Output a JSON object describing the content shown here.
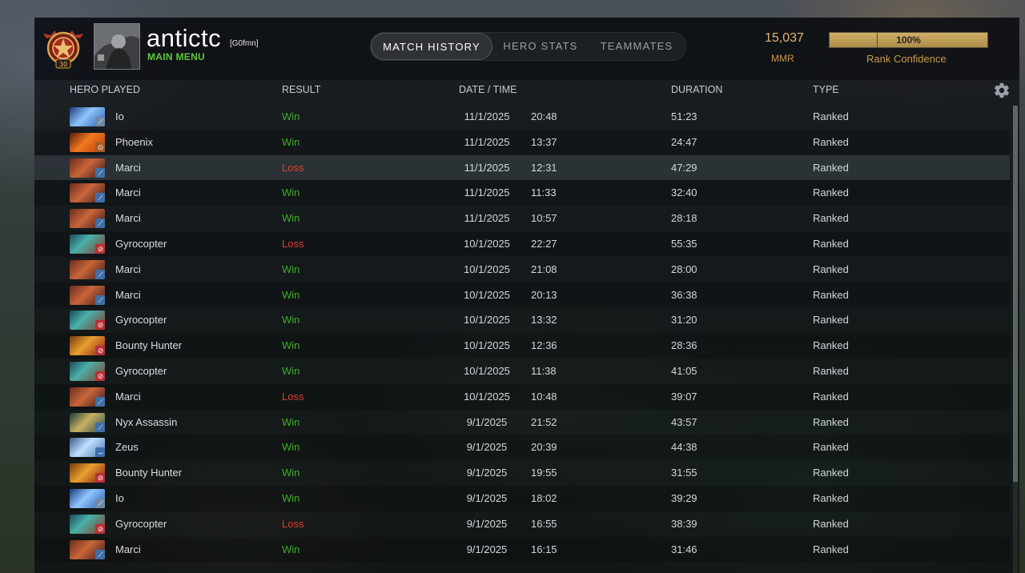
{
  "profile": {
    "username": "antictc",
    "tag": "[G0fmn]",
    "main_menu": "MAIN MENU",
    "rank_level": "30"
  },
  "tabs": [
    {
      "label": "MATCH HISTORY",
      "active": true
    },
    {
      "label": "HERO STATS",
      "active": false
    },
    {
      "label": "TEAMMATES",
      "active": false
    }
  ],
  "stats": {
    "mmr_value": "15,037",
    "mmr_label": "MMR",
    "confidence_text": "100%",
    "confidence_fraction": 1.0,
    "confidence_label": "Rank Confidence"
  },
  "columns": {
    "hero": "HERO PLAYED",
    "result": "RESULT",
    "datetime": "DATE / TIME",
    "duration": "DURATION",
    "type": "TYPE"
  },
  "colors": {
    "win": "#3fae2b",
    "loss": "#d9402f",
    "accent_gold": "#e2b66a",
    "main_menu_green": "#5ec93c"
  },
  "matches": [
    {
      "hero": "Io",
      "icon": "io-hero-icon",
      "result": "Win",
      "date": "11/1/2025",
      "time": "20:48",
      "duration": "51:23",
      "type": "Ranked"
    },
    {
      "hero": "Phoenix",
      "icon": "phoenix-hero-icon",
      "result": "Win",
      "date": "11/1/2025",
      "time": "13:37",
      "duration": "24:47",
      "type": "Ranked"
    },
    {
      "hero": "Marci",
      "icon": "marci-hero-icon",
      "result": "Loss",
      "date": "11/1/2025",
      "time": "12:31",
      "duration": "47:29",
      "type": "Ranked"
    },
    {
      "hero": "Marci",
      "icon": "marci-hero-icon",
      "result": "Win",
      "date": "11/1/2025",
      "time": "11:33",
      "duration": "32:40",
      "type": "Ranked"
    },
    {
      "hero": "Marci",
      "icon": "marci-hero-icon",
      "result": "Win",
      "date": "11/1/2025",
      "time": "10:57",
      "duration": "28:18",
      "type": "Ranked"
    },
    {
      "hero": "Gyrocopter",
      "icon": "gyrocopter-hero-icon",
      "result": "Loss",
      "date": "10/1/2025",
      "time": "22:27",
      "duration": "55:35",
      "type": "Ranked"
    },
    {
      "hero": "Marci",
      "icon": "marci-hero-icon",
      "result": "Win",
      "date": "10/1/2025",
      "time": "21:08",
      "duration": "28:00",
      "type": "Ranked"
    },
    {
      "hero": "Marci",
      "icon": "marci-hero-icon",
      "result": "Win",
      "date": "10/1/2025",
      "time": "20:13",
      "duration": "36:38",
      "type": "Ranked"
    },
    {
      "hero": "Gyrocopter",
      "icon": "gyrocopter-hero-icon",
      "result": "Win",
      "date": "10/1/2025",
      "time": "13:32",
      "duration": "31:20",
      "type": "Ranked"
    },
    {
      "hero": "Bounty Hunter",
      "icon": "bounty-hunter-hero-icon",
      "result": "Win",
      "date": "10/1/2025",
      "time": "12:36",
      "duration": "28:36",
      "type": "Ranked"
    },
    {
      "hero": "Gyrocopter",
      "icon": "gyrocopter-hero-icon",
      "result": "Win",
      "date": "10/1/2025",
      "time": "11:38",
      "duration": "41:05",
      "type": "Ranked"
    },
    {
      "hero": "Marci",
      "icon": "marci-hero-icon",
      "result": "Loss",
      "date": "10/1/2025",
      "time": "10:48",
      "duration": "39:07",
      "type": "Ranked"
    },
    {
      "hero": "Nyx Assassin",
      "icon": "nyx-assassin-hero-icon",
      "result": "Win",
      "date": "9/1/2025",
      "time": "21:52",
      "duration": "43:57",
      "type": "Ranked"
    },
    {
      "hero": "Zeus",
      "icon": "zeus-hero-icon",
      "result": "Win",
      "date": "9/1/2025",
      "time": "20:39",
      "duration": "44:38",
      "type": "Ranked"
    },
    {
      "hero": "Bounty Hunter",
      "icon": "bounty-hunter-hero-icon",
      "result": "Win",
      "date": "9/1/2025",
      "time": "19:55",
      "duration": "31:55",
      "type": "Ranked"
    },
    {
      "hero": "Io",
      "icon": "io-hero-icon",
      "result": "Win",
      "date": "9/1/2025",
      "time": "18:02",
      "duration": "39:29",
      "type": "Ranked"
    },
    {
      "hero": "Gyrocopter",
      "icon": "gyrocopter-hero-icon",
      "result": "Loss",
      "date": "9/1/2025",
      "time": "16:55",
      "duration": "38:39",
      "type": "Ranked"
    },
    {
      "hero": "Marci",
      "icon": "marci-hero-icon",
      "result": "Win",
      "date": "9/1/2025",
      "time": "16:15",
      "duration": "31:46",
      "type": "Ranked"
    }
  ]
}
